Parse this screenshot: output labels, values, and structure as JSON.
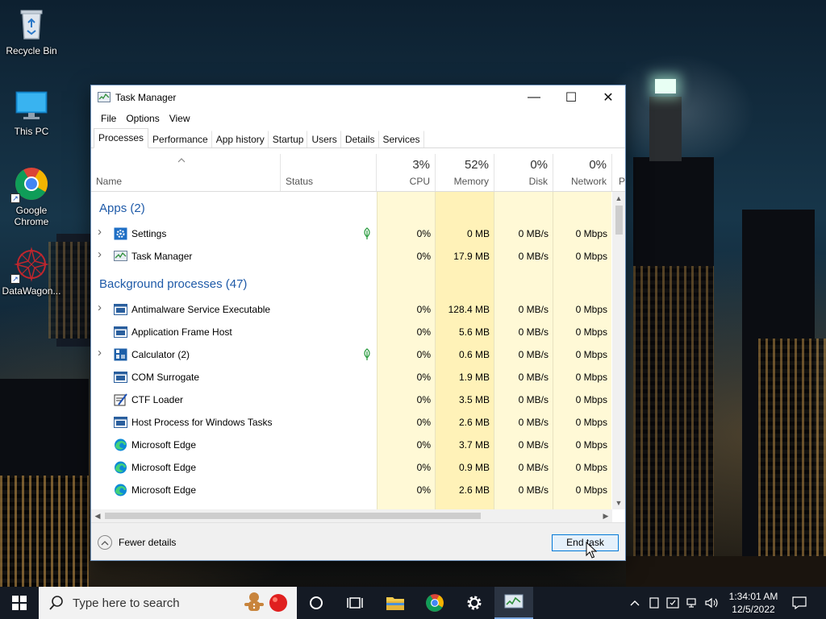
{
  "desktop": {
    "icons": [
      {
        "label": "Recycle Bin",
        "icon": "recycle-bin-icon"
      },
      {
        "label": "This PC",
        "icon": "monitor-icon"
      },
      {
        "label": "Google Chrome",
        "icon": "chrome-icon"
      },
      {
        "label": "DataWagon...",
        "icon": "datawagon-icon"
      }
    ]
  },
  "window": {
    "title": "Task Manager",
    "controls": {
      "minimize": "—",
      "maximize": "☐",
      "close": "✕"
    },
    "menu": [
      "File",
      "Options",
      "View"
    ],
    "tabs": [
      "Processes",
      "Performance",
      "App history",
      "Startup",
      "Users",
      "Details",
      "Services"
    ],
    "active_tab": "Processes",
    "columns": {
      "name": "Name",
      "status": "Status",
      "cpu": {
        "pct": "3%",
        "label": "CPU"
      },
      "memory": {
        "pct": "52%",
        "label": "Memory"
      },
      "disk": {
        "pct": "0%",
        "label": "Disk"
      },
      "network": {
        "pct": "0%",
        "label": "Network"
      },
      "power_partial": "P"
    },
    "groups": {
      "apps": "Apps (2)",
      "background": "Background processes (47)"
    },
    "apps": [
      {
        "name": "Settings",
        "icon": "gear-icon",
        "expandable": true,
        "suspended_leaf": true,
        "cpu": "0%",
        "memory": "0 MB",
        "disk": "0 MB/s",
        "network": "0 Mbps"
      },
      {
        "name": "Task Manager",
        "icon": "task-manager-icon",
        "expandable": true,
        "suspended_leaf": false,
        "cpu": "0%",
        "memory": "17.9 MB",
        "disk": "0 MB/s",
        "network": "0 Mbps"
      }
    ],
    "background": [
      {
        "name": "Antimalware Service Executable",
        "icon": "service-window-icon",
        "expandable": true,
        "suspended_leaf": false,
        "cpu": "0%",
        "memory": "128.4 MB",
        "disk": "0 MB/s",
        "network": "0 Mbps"
      },
      {
        "name": "Application Frame Host",
        "icon": "service-window-icon",
        "expandable": false,
        "suspended_leaf": false,
        "cpu": "0%",
        "memory": "5.6 MB",
        "disk": "0 MB/s",
        "network": "0 Mbps"
      },
      {
        "name": "Calculator (2)",
        "icon": "calculator-icon",
        "expandable": true,
        "suspended_leaf": true,
        "cpu": "0%",
        "memory": "0.6 MB",
        "disk": "0 MB/s",
        "network": "0 Mbps"
      },
      {
        "name": "COM Surrogate",
        "icon": "service-window-icon",
        "expandable": false,
        "suspended_leaf": false,
        "cpu": "0%",
        "memory": "1.9 MB",
        "disk": "0 MB/s",
        "network": "0 Mbps"
      },
      {
        "name": "CTF Loader",
        "icon": "ctf-loader-icon",
        "expandable": false,
        "suspended_leaf": false,
        "cpu": "0%",
        "memory": "3.5 MB",
        "disk": "0 MB/s",
        "network": "0 Mbps"
      },
      {
        "name": "Host Process for Windows Tasks",
        "icon": "service-window-icon",
        "expandable": false,
        "suspended_leaf": false,
        "cpu": "0%",
        "memory": "2.6 MB",
        "disk": "0 MB/s",
        "network": "0 Mbps"
      },
      {
        "name": "Microsoft Edge",
        "icon": "edge-icon",
        "expandable": false,
        "suspended_leaf": false,
        "cpu": "0%",
        "memory": "3.7 MB",
        "disk": "0 MB/s",
        "network": "0 Mbps"
      },
      {
        "name": "Microsoft Edge",
        "icon": "edge-icon",
        "expandable": false,
        "suspended_leaf": false,
        "cpu": "0%",
        "memory": "0.9 MB",
        "disk": "0 MB/s",
        "network": "0 Mbps"
      },
      {
        "name": "Microsoft Edge",
        "icon": "edge-icon",
        "expandable": false,
        "suspended_leaf": false,
        "cpu": "0%",
        "memory": "2.6 MB",
        "disk": "0 MB/s",
        "network": "0 Mbps"
      }
    ],
    "footer": {
      "fewer_details": "Fewer details",
      "end_task": "End task"
    }
  },
  "taskbar": {
    "search_placeholder": "Type here to search",
    "pinned": [
      "cortana-icon",
      "task-view-icon",
      "file-explorer-icon",
      "chrome-icon",
      "settings-icon",
      "task-manager-icon"
    ],
    "active_app": "task-manager-icon",
    "tray": [
      "show-hidden-icons-chevron",
      "notepad-icon",
      "security-icon",
      "network-icon",
      "volume-icon"
    ],
    "clock": {
      "time": "1:34:01 AM",
      "date": "12/5/2022"
    }
  },
  "colors": {
    "accent": "#0078d7",
    "group_heading": "#1e5aa8",
    "heat_light": "#fff9d6",
    "heat_memory": "#fff2b8",
    "taskbar": "#141a24"
  }
}
